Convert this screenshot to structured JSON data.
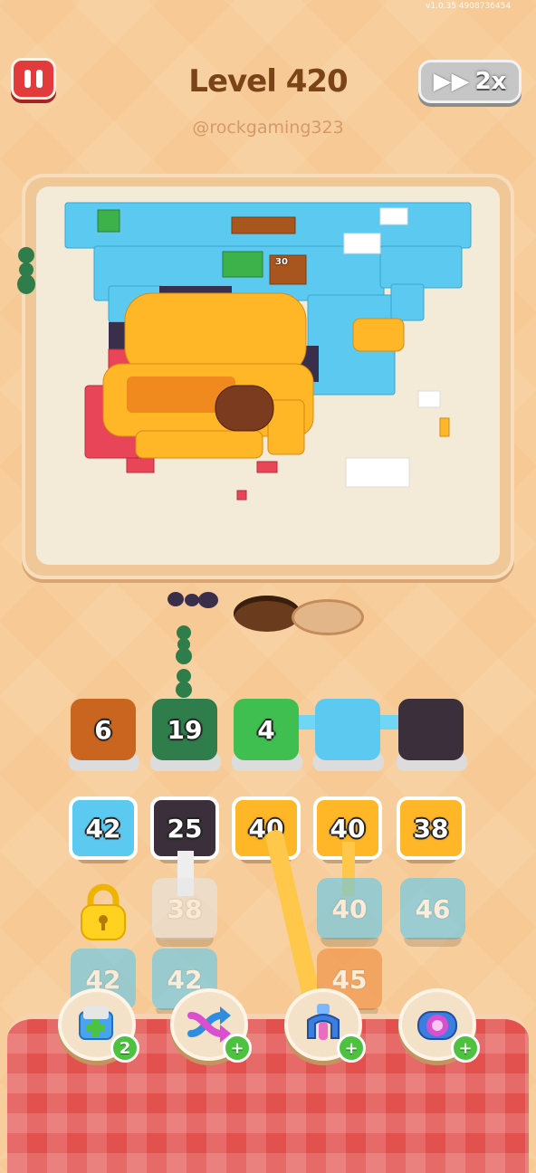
{
  "header": {
    "level_title": "Level 420",
    "username": "@rockgaming323",
    "speed_label": "2x",
    "status_text": "v1.0.35   4908736454"
  },
  "board": {
    "label_tile": "30"
  },
  "tiles": {
    "row1": [
      {
        "value": "6",
        "color": "#c9651f"
      },
      {
        "value": "19",
        "color": "#2f7d4b"
      },
      {
        "value": "4",
        "color": "#3fbf4f"
      },
      {
        "value": "",
        "color": "#5ccaf0"
      },
      {
        "value": "",
        "color": "#3a2f3a"
      }
    ],
    "row2": [
      {
        "value": "42",
        "color": "#5ccaf0"
      },
      {
        "value": "25",
        "color": "#3a2f3a"
      },
      {
        "value": "40",
        "color": "#ffb627"
      },
      {
        "value": "40",
        "color": "#ffb627"
      },
      {
        "value": "38",
        "color": "#ffb627"
      }
    ],
    "row3": [
      {
        "value": "",
        "color": "#ffd21f"
      },
      {
        "value": "38",
        "color": "#e6e6e6"
      },
      {
        "value": "",
        "color": ""
      },
      {
        "value": "40",
        "color": "#5ccaf0"
      },
      {
        "value": "46",
        "color": "#5ccaf0"
      }
    ],
    "row4": [
      {
        "value": "42",
        "color": "#5ccaf0"
      },
      {
        "value": "42",
        "color": "#5ccaf0"
      },
      {
        "value": "",
        "color": ""
      },
      {
        "value": "45",
        "color": "#f08a3a"
      },
      {
        "value": "",
        "color": ""
      }
    ]
  },
  "boosters": [
    {
      "icon": "add-slot-icon",
      "badge": "2"
    },
    {
      "icon": "shuffle-icon",
      "badge": "+"
    },
    {
      "icon": "claw-icon",
      "badge": "+"
    },
    {
      "icon": "magnet-icon",
      "badge": "+"
    }
  ],
  "colors": {
    "accent_red": "#e23b3b",
    "background": "#f6c995",
    "board": "#f3ead8",
    "sky_blue": "#5ccaf0",
    "beehive_orange": "#ffb627"
  }
}
